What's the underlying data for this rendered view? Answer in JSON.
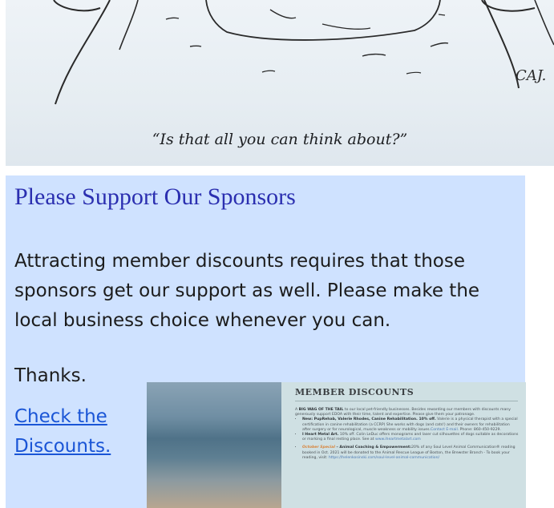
{
  "cartoon": {
    "caption": "“Is that all you can think about?”",
    "signature": "CAJ."
  },
  "sponsors": {
    "title": "Please Support Our Sponsors",
    "body": "Attracting member discounts requires that those sponsors get our support as well.  Please make the local business choice whenever you can.",
    "thanks": "Thanks.",
    "link_line1": "Check the",
    "link_line2": "Discounts."
  },
  "discount_thumbnail": {
    "heading": "MEMBER DISCOUNTS",
    "intro_a": "A ",
    "intro_bold": "BIG WAG OF THE TAIL",
    "intro_b": " to our local pet-friendly businesses.  Besides rewarding our members with discounts many generously support EDOA with their time, talent and expertise. Please give them your patronage.",
    "item1_bold": "New: PupRehab, Valerie Rhodes, Canine Rehabilitation.  10% off.",
    "item1_text": " Valerie is a physical therapist with a special certification in canine rehabilitation (a CCRP) She works with dogs (and cats!) and their owners for rehabilitation after surgery or for neurological, muscle weakness or mobility issues.",
    "item1_link": "Contact E-mail.",
    "item1_phone": " Phone: 860-450-9229.",
    "item2_bold": "I Heart Metal Art.",
    "item2_text": "  10% off. Colin LeDuc offers monograms and laser cut silhouettes of dogs suitable as decorations or marking a final resting place. See at ",
    "item2_link": "www.iheartmetalart.com",
    "item3_special": "October Special",
    "item3_bold": " – Animal Coaching & Empowerment:",
    "item3_text": "20% of any Soul Level Animal Communication® reading booked in Oct. 2021 will be donated to the Animal Rescue League of Boston, the Brewster Branch - To book your reading, visit: ",
    "item3_link": "https://helenkosinski.com/soul-level-animal-communication/"
  }
}
